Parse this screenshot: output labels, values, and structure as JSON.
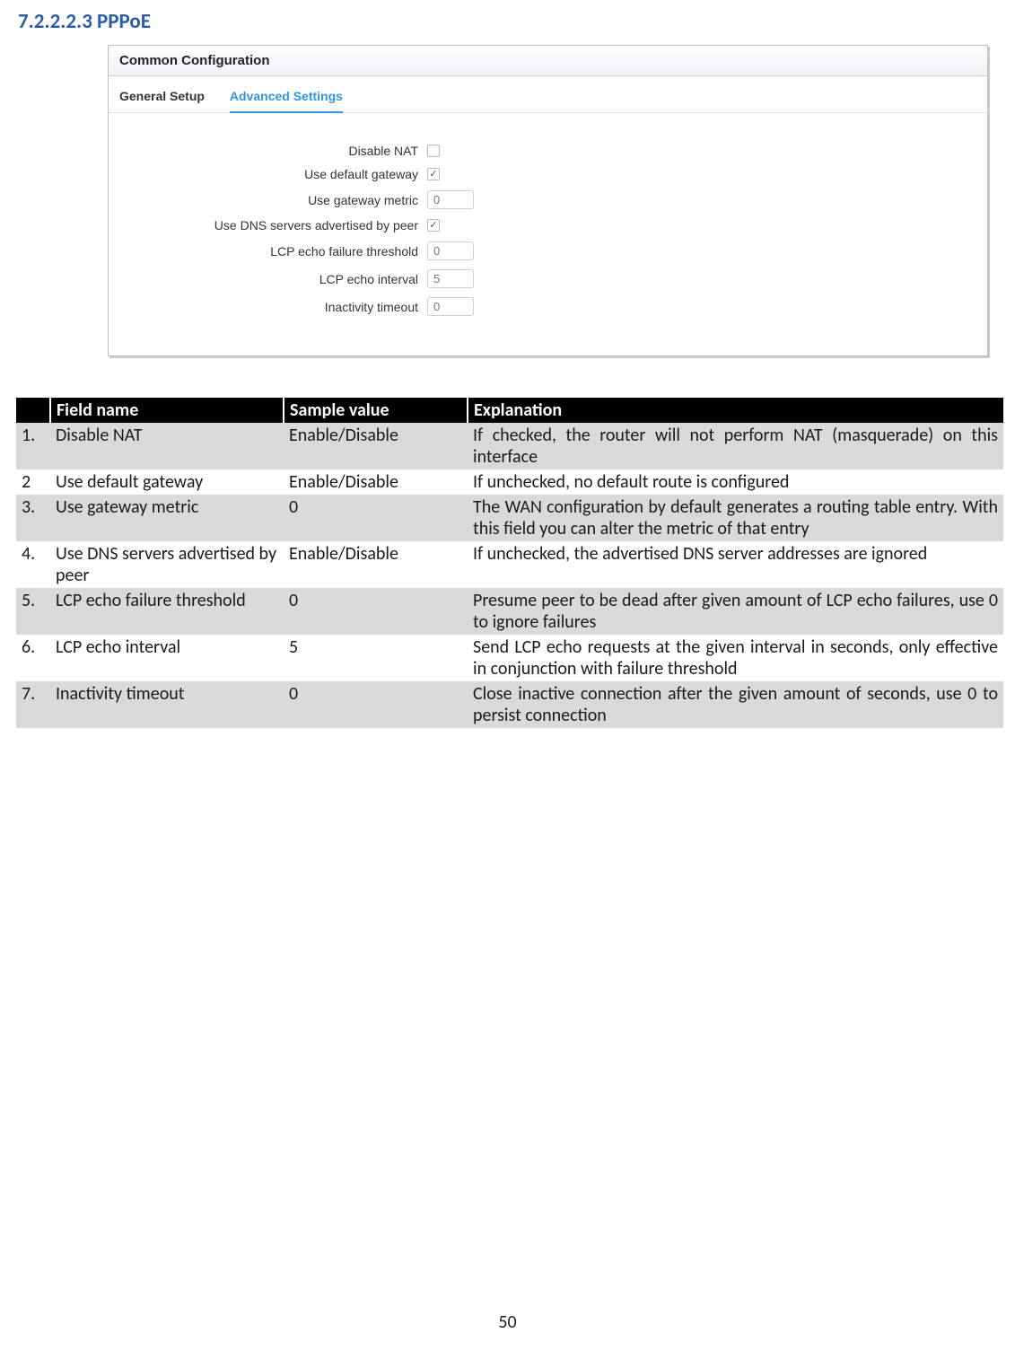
{
  "heading": "7.2.2.2.3   PPPoE",
  "panel": {
    "title": "Common Configuration",
    "tabs": {
      "general": "General Setup",
      "advanced": "Advanced Settings"
    },
    "rows": [
      {
        "label": "Disable NAT",
        "type": "checkbox",
        "checked": false
      },
      {
        "label": "Use default gateway",
        "type": "checkbox",
        "checked": true
      },
      {
        "label": "Use gateway metric",
        "type": "text",
        "value": "0"
      },
      {
        "label": "Use DNS servers advertised by peer",
        "type": "checkbox",
        "checked": true
      },
      {
        "label": "LCP echo failure threshold",
        "type": "text",
        "value": "0"
      },
      {
        "label": "LCP echo interval",
        "type": "text",
        "value": "5"
      },
      {
        "label": "Inactivity timeout",
        "type": "text",
        "value": "0"
      }
    ]
  },
  "table": {
    "headers": {
      "num": " ",
      "name": "Field name",
      "val": "Sample value",
      "exp": "Explanation"
    },
    "rows": [
      {
        "num": "1.",
        "name": "Disable NAT",
        "val": "Enable/Disable",
        "exp": "If checked, the router will not perform NAT (masquerade) on this interface"
      },
      {
        "num": "2",
        "name": "Use default gateway",
        "val": "Enable/Disable",
        "exp": "If unchecked, no default route is configured"
      },
      {
        "num": "3.",
        "name": "Use gateway metric",
        "val": "0",
        "exp": "The WAN configuration by default generates a routing table entry. With this field you can alter the metric of that entry"
      },
      {
        "num": "4.",
        "name": "Use DNS servers advertised by peer",
        "val": "Enable/Disable",
        "exp": "If unchecked, the advertised DNS server addresses are ignored"
      },
      {
        "num": "5.",
        "name": "LCP echo failure threshold",
        "val": "0",
        "exp": "Presume peer to be dead after given amount of LCP echo failures, use 0 to ignore failures"
      },
      {
        "num": "6.",
        "name": "LCP echo interval",
        "val": "5",
        "exp": "Send LCP echo requests at the given interval in seconds, only effective in conjunction with failure threshold"
      },
      {
        "num": "7.",
        "name": "Inactivity timeout",
        "val": "0",
        "exp": "Close inactive connection after the given amount of seconds, use 0 to persist connection"
      }
    ]
  },
  "pageNumber": "50"
}
